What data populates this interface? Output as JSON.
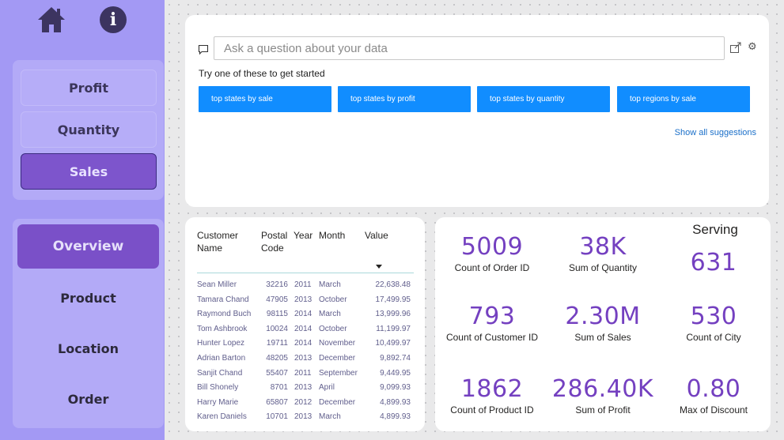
{
  "sidebar": {
    "icons": {
      "home": "home-icon",
      "info": "info-icon"
    },
    "metric_buttons": [
      {
        "label": "Profit"
      },
      {
        "label": "Quantity"
      },
      {
        "label": "Sales"
      }
    ],
    "nav_buttons": [
      {
        "label": "Overview"
      },
      {
        "label": "Product"
      },
      {
        "label": "Location"
      },
      {
        "label": "Order"
      }
    ],
    "active_metric": "Sales",
    "active_nav": "Overview"
  },
  "qa": {
    "placeholder": "Ask a question about your data",
    "try_text": "Try one of these to get started",
    "suggestions": [
      "top states by sale",
      "top states by profit",
      "top states by quantity",
      "top regions by sale"
    ],
    "show_all": "Show all suggestions"
  },
  "table": {
    "headers": {
      "name": "Customer\nName",
      "code": "Postal\nCode",
      "year": "Year",
      "month": "Month",
      "value": "Value"
    },
    "rows": [
      {
        "name": "Sean Miller",
        "code": "32216",
        "year": "2011",
        "month": "March",
        "value": "22,638.48"
      },
      {
        "name": "Tamara Chand",
        "code": "47905",
        "year": "2013",
        "month": "October",
        "value": "17,499.95"
      },
      {
        "name": "Raymond Buch",
        "code": "98115",
        "year": "2014",
        "month": "March",
        "value": "13,999.96"
      },
      {
        "name": "Tom Ashbrook",
        "code": "10024",
        "year": "2014",
        "month": "October",
        "value": "11,199.97"
      },
      {
        "name": "Hunter Lopez",
        "code": "19711",
        "year": "2014",
        "month": "November",
        "value": "10,499.97"
      },
      {
        "name": "Adrian Barton",
        "code": "48205",
        "year": "2013",
        "month": "December",
        "value": "9,892.74"
      },
      {
        "name": "Sanjit Chand",
        "code": "55407",
        "year": "2011",
        "month": "September",
        "value": "9,449.95"
      },
      {
        "name": "Bill Shonely",
        "code": "8701",
        "year": "2013",
        "month": "April",
        "value": "9,099.93"
      },
      {
        "name": "Harry Marie",
        "code": "65807",
        "year": "2012",
        "month": "December",
        "value": "4,899.93"
      },
      {
        "name": "Karen Daniels",
        "code": "10701",
        "year": "2013",
        "month": "March",
        "value": "4,899.93"
      }
    ]
  },
  "kpis": {
    "serving_title": "Serving",
    "items": [
      {
        "value": "5009",
        "label": "Count of Order ID"
      },
      {
        "value": "38K",
        "label": "Sum of Quantity"
      },
      {
        "value": "631",
        "label": ""
      },
      {
        "value": "793",
        "label": "Count of Customer ID"
      },
      {
        "value": "2.30M",
        "label": "Sum of Sales"
      },
      {
        "value": "530",
        "label": "Count of City"
      },
      {
        "value": "1862",
        "label": "Count of Product ID"
      },
      {
        "value": "286.40K",
        "label": "Sum of Profit"
      },
      {
        "value": "0.80",
        "label": "Max of Discount"
      }
    ]
  },
  "colors": {
    "sidebar_bg": "#a399f4",
    "accent_purple": "#7a50c8",
    "kpi_value": "#7440c0",
    "suggestion_blue": "#118dff"
  }
}
